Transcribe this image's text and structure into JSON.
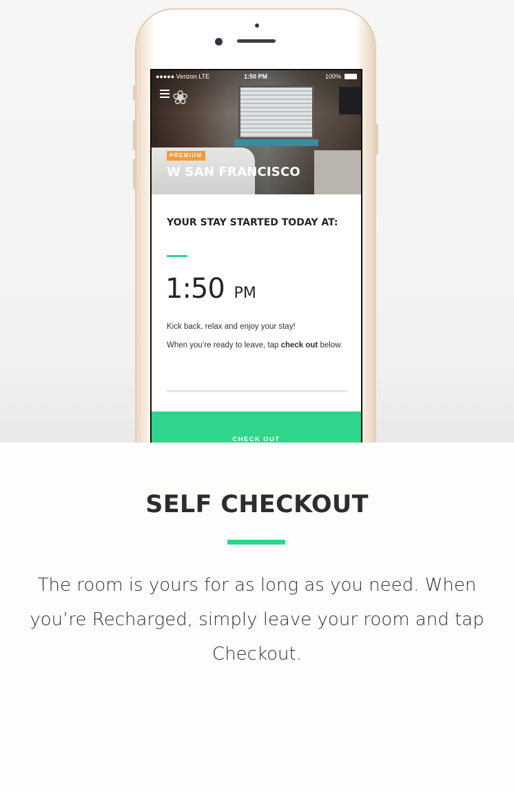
{
  "phone": {
    "status": {
      "carrier": "●●●●● Verizon LTE",
      "time": "1:50 PM",
      "battery": "100%"
    },
    "hotel": {
      "badge": "PREMIUM",
      "name": "W SAN FRANCISCO"
    },
    "stay": {
      "label": "YOUR STAY STARTED TODAY AT:",
      "time": "1:50",
      "ampm": "PM",
      "message1": "Kick back, relax and enjoy your stay!",
      "message2_pre": "When you’re ready to leave, tap ",
      "message2_bold": "check out",
      "message2_post": " below."
    },
    "checkout_button": "CHECK OUT"
  },
  "section": {
    "title": "SELF CHECKOUT",
    "description": "The room is yours for as long as you need. When you’re Recharged, simply leave your room and tap Checkout."
  },
  "colors": {
    "accent": "#2fd58b",
    "badge": "#f39a3a",
    "text": "#2b2d31"
  }
}
